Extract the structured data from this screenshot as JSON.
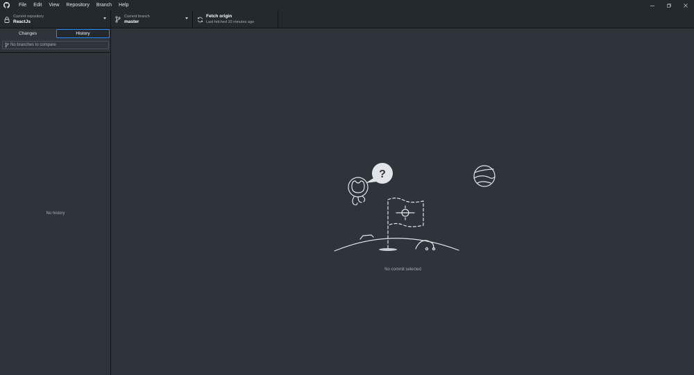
{
  "menu": {
    "items": [
      "File",
      "Edit",
      "View",
      "Repository",
      "Branch",
      "Help"
    ]
  },
  "toolbar": {
    "repo_label": "Current repository",
    "repo_value": "ReactJs",
    "branch_label": "Current branch",
    "branch_value": "master",
    "fetch_title": "Fetch origin",
    "fetch_subtitle": "Last fetched 10 minutes ago"
  },
  "sidebar": {
    "tabs": [
      {
        "label": "Changes",
        "selected": false
      },
      {
        "label": "History",
        "selected": true
      }
    ],
    "compare_placeholder": "No branches to compare",
    "empty_text": "No history"
  },
  "main": {
    "empty_text": "No commit selected"
  },
  "icons": {
    "app": "github-logo-icon",
    "repo": "lock-icon",
    "branch": "git-branch-icon",
    "fetch": "sync-icon",
    "compare": "git-branch-icon"
  },
  "colors": {
    "accent": "#2188ff",
    "background": "#2f343b",
    "chrome": "#24292e"
  }
}
